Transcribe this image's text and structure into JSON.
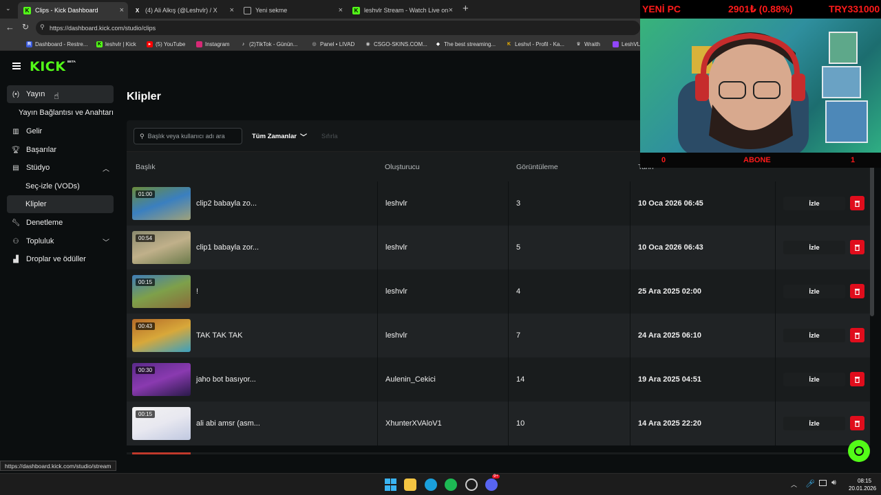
{
  "browser": {
    "tabs": [
      {
        "title": "Clips - Kick Dashboard",
        "icon": "kick-icon",
        "active": true
      },
      {
        "title": "(4) Ali Alkış (@Leshvlr) / X",
        "icon": "x-icon",
        "active": false
      },
      {
        "title": "Yeni sekme",
        "icon": "new-tab-icon",
        "active": false
      },
      {
        "title": "leshvlr Stream - Watch Live on Kick",
        "icon": "kick-icon",
        "active": false
      }
    ],
    "url": "https://dashboard.kick.com/studio/clips",
    "bookmarks": [
      "Dashboard - Restre...",
      "leshvlr | Kick",
      "(5) YouTube",
      "Instagram",
      "(2)TikTok - Günün...",
      "Panel • LIVAD",
      "CSGO-SKINS.COM...",
      "The best streaming...",
      "Leshvl - Profil - Ka...",
      "Wraith",
      "LeshVL"
    ],
    "status_url": "https://dashboard.kick.com/studio/stream"
  },
  "nav": {
    "logo": "KICK",
    "logo_badge": "BETA"
  },
  "sidebar": {
    "items": [
      {
        "label": "Yayın",
        "icon": "broadcast-icon"
      },
      {
        "label": "Yayın Bağlantısı ve Anahtarı",
        "icon": ""
      },
      {
        "label": "Gelir",
        "icon": "chart-icon"
      },
      {
        "label": "Başarılar",
        "icon": "trophy-icon"
      },
      {
        "label": "Stüdyo",
        "icon": "studio-icon"
      },
      {
        "label": "Seç-izle (VODs)",
        "icon": ""
      },
      {
        "label": "Klipler",
        "icon": ""
      },
      {
        "label": "Denetleme",
        "icon": "wrench-icon"
      },
      {
        "label": "Topluluk",
        "icon": "community-icon"
      },
      {
        "label": "Droplar ve ödüller",
        "icon": "drops-icon"
      }
    ]
  },
  "main": {
    "title": "Klipler",
    "search_placeholder": "Başlık veya kullanıcı adı ara",
    "time_filter": "Tüm Zamanlar",
    "clear_label": "Sıfırla",
    "columns": [
      "Başlık",
      "Oluşturucu",
      "Görüntüleme",
      "Tarih"
    ],
    "watch_label": "İzle",
    "clips": [
      {
        "duration": "01:00",
        "title": "clip2 babayla zo...",
        "creator": "leshvlr",
        "views": "3",
        "date": "10 Oca 2026 06:45"
      },
      {
        "duration": "00:54",
        "title": "clip1 babayla zor...",
        "creator": "leshvlr",
        "views": "5",
        "date": "10 Oca 2026 06:43"
      },
      {
        "duration": "00:15",
        "title": "!",
        "creator": "leshvlr",
        "views": "4",
        "date": "25 Ara 2025 02:00"
      },
      {
        "duration": "00:43",
        "title": "TAK TAK TAK",
        "creator": "leshvlr",
        "views": "7",
        "date": "24 Ara 2025 06:10"
      },
      {
        "duration": "00:30",
        "title": "jaho bot basıyor...",
        "creator": "Aulenin_Cekici",
        "views": "14",
        "date": "19 Ara 2025 04:51"
      },
      {
        "duration": "00:15",
        "title": "ali abi amsr (asm...",
        "creator": "XhunterXVAloV1",
        "views": "10",
        "date": "14 Ara 2025 22:20"
      }
    ]
  },
  "overlay": {
    "left": "YENİ PC",
    "mid": "2901₺ (0.88%)",
    "right": "TRY331000",
    "bar_left": "0",
    "bar_mid": "ABONE",
    "bar_right": "1"
  },
  "taskbar": {
    "time": "08:15",
    "date": "20.01.2026",
    "discord_badge": "9+"
  },
  "colors": {
    "kick_green": "#53fc18",
    "delete_red": "#e00d1c",
    "overlay_red": "#ff1a1a"
  }
}
